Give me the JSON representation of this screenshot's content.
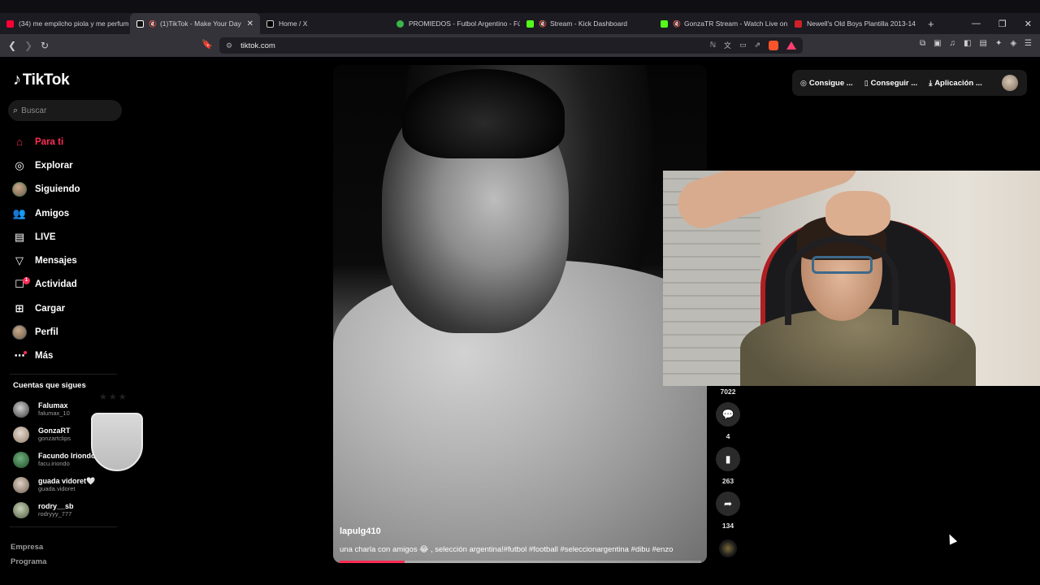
{
  "browser": {
    "tabs": [
      {
        "label": "(34) me empilcho piola y me perfum",
        "color": "#ff0033",
        "muted": false,
        "active": false
      },
      {
        "label": "(1)TikTok - Make Your Day",
        "color": "#ffffff",
        "muted": true,
        "active": true
      },
      {
        "label": "Home / X",
        "color": "#ffffff",
        "muted": false,
        "active": false
      },
      {
        "label": "PROMIEDOS - Futbol Argentino - Fú",
        "color": "#3bb54a",
        "muted": false,
        "active": false
      },
      {
        "label": "Stream - Kick Dashboard",
        "color": "#53fc18",
        "muted": true,
        "active": false
      },
      {
        "label": "GonzaTR Stream - Watch Live on",
        "color": "#53fc18",
        "muted": true,
        "active": false
      },
      {
        "label": "Newell's Old Boys Plantilla 2013-14",
        "color": "#d0202a",
        "muted": false,
        "active": false
      }
    ],
    "url": "tiktok.com"
  },
  "tiktok": {
    "logo": "TikTok",
    "search_placeholder": "Buscar",
    "nav": [
      {
        "label": "Para ti",
        "icon": "home-icon",
        "active": true
      },
      {
        "label": "Explorar",
        "icon": "compass-icon",
        "active": false
      },
      {
        "label": "Siguiendo",
        "icon": "avatar-icon",
        "active": false
      },
      {
        "label": "Amigos",
        "icon": "friends-icon",
        "active": false
      },
      {
        "label": "LIVE",
        "icon": "live-icon",
        "active": false
      },
      {
        "label": "Mensajes",
        "icon": "send-icon",
        "active": false
      },
      {
        "label": "Actividad",
        "icon": "activity-icon",
        "active": false,
        "badge": "1"
      },
      {
        "label": "Cargar",
        "icon": "upload-icon",
        "active": false
      },
      {
        "label": "Perfil",
        "icon": "profile-icon",
        "active": false
      },
      {
        "label": "Más",
        "icon": "more-icon",
        "active": false
      }
    ],
    "following_title": "Cuentas que sigues",
    "following": [
      {
        "name": "Falumax",
        "user": "falumax_10",
        "color": "#6b6b6b"
      },
      {
        "name": "GonzaRT",
        "user": "gonzartclips",
        "color": "#a08a76"
      },
      {
        "name": "Facundo Iriondo",
        "user": "facu.iriondo",
        "color": "#2f6b3c"
      },
      {
        "name": "guada vidoret🤍",
        "user": "guada.vidoret",
        "color": "#8b7a6b"
      },
      {
        "name": "rodry__sb",
        "user": "rodryyy_777",
        "color": "#7a8b6b"
      }
    ],
    "footer": [
      "Empresa",
      "Programa"
    ],
    "top_buttons": [
      "Consigue ...",
      "Conseguir ...",
      "Aplicación ..."
    ],
    "video": {
      "user": "lapulg410",
      "description": "una charla con amigos 😂 , selección argentina!#futbol #football #seleccionargentina #dibu #enzo",
      "progress": 0.18
    },
    "actions": [
      {
        "icon": "heart-icon",
        "count": "7022"
      },
      {
        "icon": "comment-icon",
        "count": "4"
      },
      {
        "icon": "bookmark-icon",
        "count": "263"
      },
      {
        "icon": "share-icon",
        "count": "134"
      }
    ]
  }
}
